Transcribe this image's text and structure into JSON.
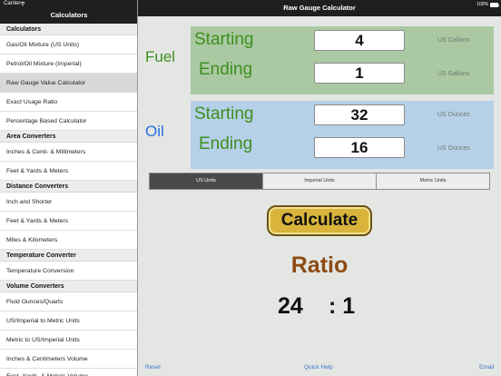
{
  "status": {
    "carrier": "Carrier",
    "battery_percent": "100%",
    "battery_level": 1.0
  },
  "sidebar": {
    "title": "Calculators",
    "sections": [
      {
        "header": "Calculators",
        "items": [
          {
            "label": "Gas/Oil Mixture (US Units)",
            "selected": false
          },
          {
            "label": "Petrol/Oil Mixture (Imperial)",
            "selected": false
          },
          {
            "label": "Raw Gauge Value Calculator",
            "selected": true
          },
          {
            "label": "Exact Usage Ratio",
            "selected": false
          },
          {
            "label": "Percentage Based Calculator",
            "selected": false
          }
        ]
      },
      {
        "header": "Area Converters",
        "items": [
          {
            "label": "Inches & Centi- & Millimeters",
            "selected": false
          },
          {
            "label": "Feet & Yards & Meters",
            "selected": false
          }
        ]
      },
      {
        "header": "Distance Converters",
        "items": [
          {
            "label": "Inch and Shorter",
            "selected": false
          },
          {
            "label": "Feet & Yards & Meters",
            "selected": false
          },
          {
            "label": "Miles & Kilometers",
            "selected": false
          }
        ]
      },
      {
        "header": "Temperature Converter",
        "items": [
          {
            "label": "Temperature Conversion",
            "selected": false
          }
        ]
      },
      {
        "header": "Volume Converters",
        "items": [
          {
            "label": "Fluid Ounces/Quarts",
            "selected": false
          },
          {
            "label": "US/Imperial to Metric Units",
            "selected": false
          },
          {
            "label": "Metric to US/Imperial Units",
            "selected": false
          },
          {
            "label": "Inches & Centimeters Volume",
            "selected": false
          },
          {
            "label": "Feet, Yards, & Meters Volume",
            "selected": false
          }
        ]
      }
    ]
  },
  "main": {
    "title": "Raw Gauge Calculator",
    "fuel": {
      "label": "Fuel",
      "starting_label": "Starting",
      "starting_value": "4",
      "ending_label": "Ending",
      "ending_value": "1",
      "unit": "US Gallons"
    },
    "oil": {
      "label": "Oil",
      "starting_label": "Starting",
      "starting_value": "32",
      "ending_label": "Ending",
      "ending_value": "16",
      "unit": "US Ounces"
    },
    "units_tabs": [
      {
        "label": "US Units",
        "active": true
      },
      {
        "label": "Imperial Units",
        "active": false
      },
      {
        "label": "Metric Units",
        "active": false
      }
    ],
    "calculate_label": "Calculate",
    "ratio_label": "Ratio",
    "ratio_left": "24",
    "ratio_right": ": 1"
  },
  "bottom_bar": {
    "reset": "Reset",
    "help": "Quick Help",
    "email": "Email"
  },
  "colors": {
    "fuel_green": "#3e8f1f",
    "oil_blue": "#2a6edc",
    "fuel_panel": "#aac9a2",
    "oil_panel": "#b6d0e8",
    "calculate_gold": "#d8b43a",
    "ratio_brown": "#8c4a12",
    "link_blue": "#3b73c9"
  }
}
